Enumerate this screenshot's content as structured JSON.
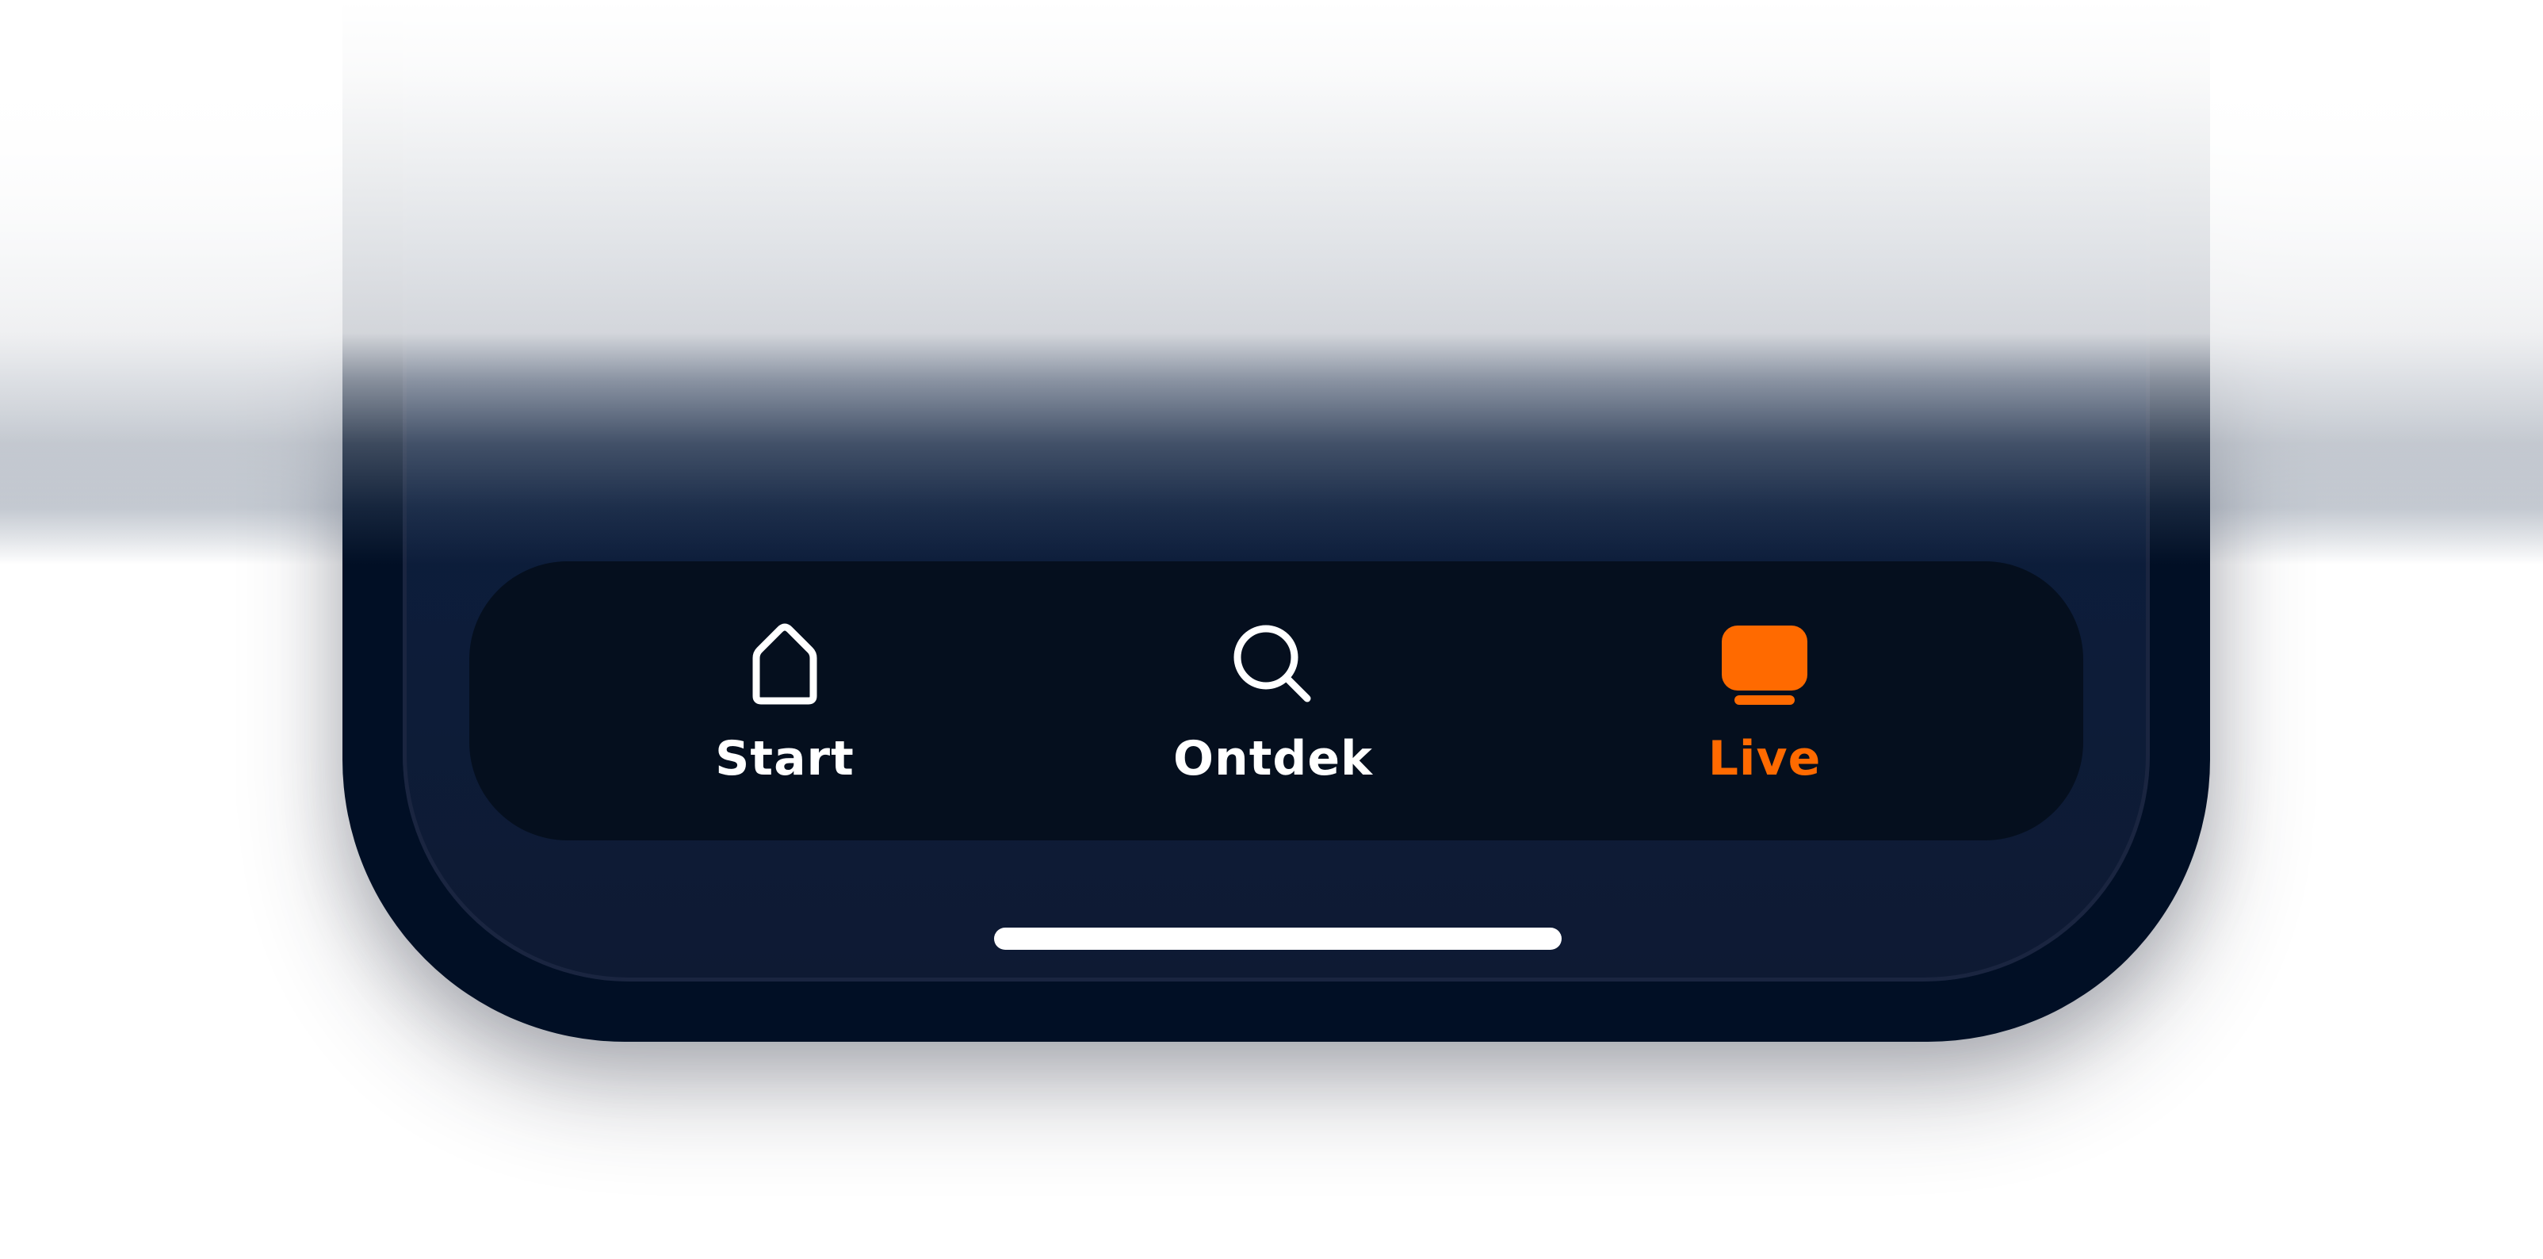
{
  "tabbar": {
    "tabs": [
      {
        "label": "Start",
        "icon": "home-icon",
        "active": false
      },
      {
        "label": "Ontdek",
        "icon": "search-icon",
        "active": false
      },
      {
        "label": "Live",
        "icon": "tv-icon",
        "active": true
      }
    ]
  },
  "colors": {
    "accent": "#ff6a00",
    "inactive": "#ffffff",
    "tabbar_bg": "#050f1e",
    "screen_bg": "#0a2247",
    "bezel": "#010f25"
  }
}
